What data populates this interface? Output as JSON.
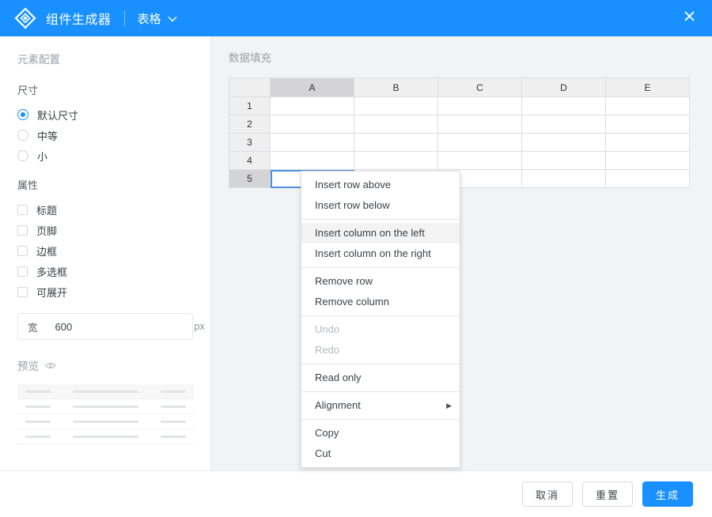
{
  "header": {
    "logo_icon": "diamond-logo-icon",
    "title": "组件生成器",
    "component_select": "表格",
    "chevron": "∨",
    "close_icon": "✕",
    "accent_color": "#1890ff"
  },
  "sidebar": {
    "section_title": "元素配置",
    "size": {
      "label": "尺寸",
      "options": [
        {
          "label": "默认尺寸",
          "checked": true
        },
        {
          "label": "中等",
          "checked": false
        },
        {
          "label": "小",
          "checked": false
        }
      ]
    },
    "attributes": {
      "label": "属性",
      "options": [
        {
          "label": "标题",
          "checked": false
        },
        {
          "label": "页脚",
          "checked": false
        },
        {
          "label": "边框",
          "checked": false
        },
        {
          "label": "多选框",
          "checked": false
        },
        {
          "label": "可展开",
          "checked": false
        }
      ]
    },
    "width_field": {
      "prefix": "宽",
      "value": "600",
      "placeholder": "600",
      "suffix": "px"
    },
    "preview": {
      "label": "预览",
      "eye_icon": "eye-icon"
    }
  },
  "main": {
    "title": "数据填充",
    "sheet": {
      "columns": [
        "A",
        "B",
        "C",
        "D",
        "E"
      ],
      "rows": [
        "1",
        "2",
        "3",
        "4",
        "5"
      ],
      "selected_column": "A",
      "selected_row": "5",
      "active_cell": "A5",
      "cells": [
        [
          "",
          "",
          "",
          "",
          ""
        ],
        [
          "",
          "",
          "",
          "",
          ""
        ],
        [
          "",
          "",
          "",
          "",
          ""
        ],
        [
          "",
          "",
          "",
          "",
          ""
        ],
        [
          "",
          "",
          "",
          "",
          ""
        ]
      ]
    }
  },
  "context_menu": {
    "items": [
      {
        "label": "Insert row above",
        "state": "normal"
      },
      {
        "label": "Insert row below",
        "state": "normal"
      },
      {
        "sep": true
      },
      {
        "label": "Insert column on the left",
        "state": "hover"
      },
      {
        "label": "Insert column on the right",
        "state": "normal"
      },
      {
        "sep": true
      },
      {
        "label": "Remove row",
        "state": "normal"
      },
      {
        "label": "Remove column",
        "state": "normal"
      },
      {
        "sep": true
      },
      {
        "label": "Undo",
        "state": "disabled"
      },
      {
        "label": "Redo",
        "state": "disabled"
      },
      {
        "sep": true
      },
      {
        "label": "Read only",
        "state": "normal"
      },
      {
        "sep": true
      },
      {
        "label": "Alignment",
        "state": "normal",
        "submenu": true,
        "arrow": "▶"
      },
      {
        "sep": true
      },
      {
        "label": "Copy",
        "state": "normal"
      },
      {
        "label": "Cut",
        "state": "normal"
      }
    ]
  },
  "footer": {
    "cancel_label": "取消",
    "reset_label": "重置",
    "generate_label": "生成"
  }
}
